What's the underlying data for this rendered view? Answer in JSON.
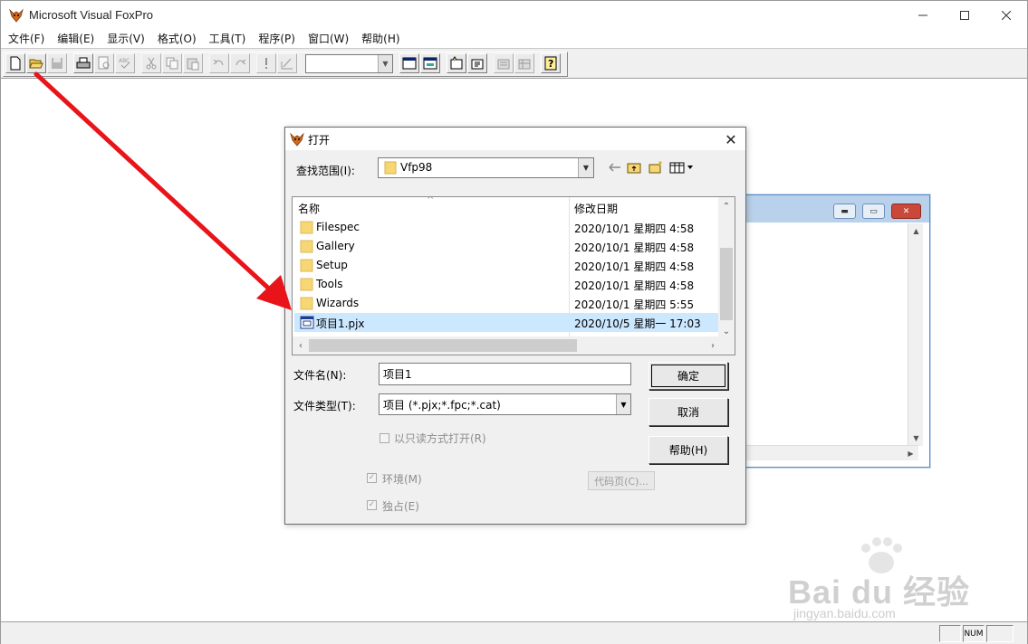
{
  "app": {
    "title": "Microsoft Visual FoxPro",
    "window_controls": {
      "minimize": "—",
      "maximize": "☐",
      "close": "✕"
    }
  },
  "menubar": [
    {
      "label": "文件(F)"
    },
    {
      "label": "编辑(E)"
    },
    {
      "label": "显示(V)"
    },
    {
      "label": "格式(O)"
    },
    {
      "label": "工具(T)"
    },
    {
      "label": "程序(P)"
    },
    {
      "label": "窗口(W)"
    },
    {
      "label": "帮助(H)"
    }
  ],
  "toolbar": {
    "buttons": [
      "new-file-icon",
      "open-folder-icon",
      "save-icon",
      "print-icon",
      "print-preview-icon",
      "spelling-icon",
      "cut-icon",
      "copy-icon",
      "paste-icon",
      "undo-icon",
      "redo-icon",
      "run-icon",
      "modify-form-icon",
      "command-window-icon",
      "data-session-icon",
      "form-designer-icon",
      "report-icon",
      "database-icon",
      "table-icon",
      "code-icon",
      "help-icon"
    ],
    "combo_value": ""
  },
  "dialog": {
    "title": "打开",
    "look_in_label": "查找范围(I):",
    "look_in_value": "Vfp98",
    "columns": {
      "name": "名称",
      "date": "修改日期"
    },
    "files": [
      {
        "name": "Filespec",
        "date": "2020/10/1 星期四 4:58",
        "type": "folder",
        "selected": false
      },
      {
        "name": "Gallery",
        "date": "2020/10/1 星期四 4:58",
        "type": "folder",
        "selected": false
      },
      {
        "name": "Setup",
        "date": "2020/10/1 星期四 4:58",
        "type": "folder",
        "selected": false
      },
      {
        "name": "Tools",
        "date": "2020/10/1 星期四 4:58",
        "type": "folder",
        "selected": false
      },
      {
        "name": "Wizards",
        "date": "2020/10/1 星期四 5:55",
        "type": "folder",
        "selected": false
      },
      {
        "name": "项目1.pjx",
        "date": "2020/10/5 星期一 17:03",
        "type": "project",
        "selected": true
      }
    ],
    "filename_label": "文件名(N):",
    "filename_value": "项目1",
    "filetype_label": "文件类型(T):",
    "filetype_value": "项目 (*.pjx;*.fpc;*.cat)",
    "readonly_label": "以只读方式打开(R)",
    "environment_label": "环境(M)",
    "exclusive_label": "独占(E)",
    "codepage_label": "代码页(C)...",
    "ok_label": "确定",
    "cancel_label": "取消",
    "help_label": "帮助(H)",
    "close_glyph": "✕"
  },
  "statusbar": {
    "num": "NUM"
  },
  "watermark": {
    "brand": "Bai du 经验",
    "url": "jingyan.baidu.com"
  },
  "colors": {
    "selection": "#cce8ff",
    "arrow": "#e8141a",
    "folder": "#f7d774"
  }
}
